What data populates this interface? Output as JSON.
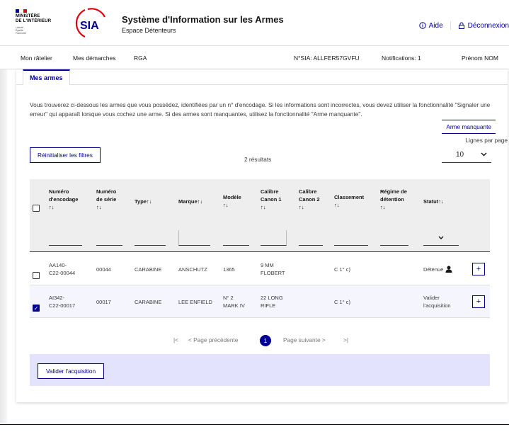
{
  "header": {
    "ministry": "MINISTÈRE\nDE L'INTÉRIEUR",
    "devise": "Liberté\nÉgalité\nFraternité",
    "logo_text": "SIA",
    "app_title": "Système d'Information sur les Armes",
    "app_subtitle": "Espace Détenteurs",
    "help_label": "Aide",
    "logout_label": "Déconnexion",
    "flag_colors": [
      "#000091",
      "#ffffff",
      "#e1000f"
    ]
  },
  "nav": {
    "items": [
      "Mon râtelier",
      "Mes démarches",
      "RGA"
    ],
    "sia_number": "N°SIA: ALLFER57GVFU",
    "notifications": "Notifications: 1",
    "user": "Prénom NOM"
  },
  "main": {
    "tab": "Mes armes",
    "intro": "Vous trouverez ci-dessous les armes que vous possédez, identifiées par un n° d'encodage. Si les informations sont incorrectes, vous devez utiliser la fonctionnalité \"Signaler une erreur\" qui apparaît lorsque vous cochez une arme. Si des armes sont manquantes, utilisez la fonctionnalité \"Arme manquante\".",
    "missing_weapon_label": "Arme manquante",
    "lines_per_page_label": "Lignes par page",
    "lines_per_page_value": "10",
    "reset_filters_label": "Réinitialiser les filtres",
    "results_count": "2 résultats"
  },
  "table": {
    "sort_icon": "↑↓",
    "columns": [
      {
        "label": "Numéro\nd'encodage",
        "sort": "\n↑↓"
      },
      {
        "label": "Numéro\nde série",
        "sort": "\n↑↓"
      },
      {
        "label": "Type",
        "sort": "↑↓"
      },
      {
        "label": "Marque",
        "sort": "↑↓"
      },
      {
        "label": "Modèle",
        "sort": "\n↑↓"
      },
      {
        "label": "Calibre\nCanon 1",
        "sort": "\n↑↓"
      },
      {
        "label": "Calibre\nCanon 2",
        "sort": "\n↑↓"
      },
      {
        "label": "Classement",
        "sort": "\n↑↓"
      },
      {
        "label": "Régime de\ndétention",
        "sort": "\n↑↓"
      },
      {
        "label": "Statut",
        "sort": "↑↓"
      }
    ],
    "rows": [
      {
        "encodage": "AA140-\nC22-00044",
        "serie": "00044",
        "type": "CARABINE",
        "marque": "ANSCHUTZ",
        "modele": "1365",
        "calibre1": "9 MM\nFLOBERT",
        "calibre2": "",
        "classement": "C 1° c)",
        "regime": "",
        "statut": "Détenue",
        "checked": false
      },
      {
        "encodage": "AI342-\nC22-00017",
        "serie": "00017",
        "type": "CARABINE",
        "marque": "LEE ENFIELD",
        "modele": "N° 2\nMARK IV",
        "calibre1": "22 LONG\nRIFLE",
        "calibre2": "",
        "classement": "C 1° c)",
        "regime": "",
        "statut": "Valider\nl'acquisition",
        "checked": true
      }
    ]
  },
  "pagination": {
    "first": "|<",
    "prev": "< Page précédente",
    "current": "1",
    "next": "Page suivante >",
    "last": ">|"
  },
  "actions": {
    "validate_label": "Valider l'acquisition"
  },
  "colors": {
    "primary": "#000091",
    "header_bg": "#eeeeee",
    "action_bar": "#e3e3fd"
  }
}
